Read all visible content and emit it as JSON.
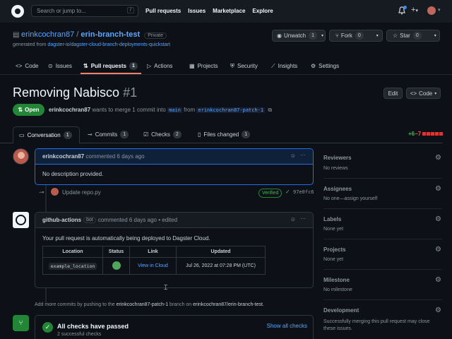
{
  "header": {
    "search_placeholder": "Search or jump to...",
    "search_key": "/",
    "nav": [
      "Pull requests",
      "Issues",
      "Marketplace",
      "Explore"
    ]
  },
  "repo": {
    "owner": "erinkcochran87",
    "slash": "/",
    "name": "erin-branch-test",
    "visibility": "Private",
    "generated_prefix": "generated from ",
    "generated_from": "dagster-io/dagster-cloud-branch-deployments-quickstart",
    "unwatch_label": "Unwatch",
    "unwatch_count": "1",
    "fork_label": "Fork",
    "fork_count": "0",
    "star_label": "Star",
    "star_count": "0"
  },
  "tabs": [
    {
      "label": "Code",
      "count": ""
    },
    {
      "label": "Issues",
      "count": ""
    },
    {
      "label": "Pull requests",
      "count": "1"
    },
    {
      "label": "Actions",
      "count": ""
    },
    {
      "label": "Projects",
      "count": ""
    },
    {
      "label": "Security",
      "count": ""
    },
    {
      "label": "Insights",
      "count": ""
    },
    {
      "label": "Settings",
      "count": ""
    }
  ],
  "pr": {
    "title": "Removing Nabisco",
    "number": "#1",
    "edit_label": "Edit",
    "code_label": "Code",
    "state": "Open",
    "meta_author": "erinkcochran87",
    "meta_text": " wants to merge 1 commit into ",
    "base_branch": "main",
    "from_text": " from ",
    "head_branch": "erinkcochran87-patch-1"
  },
  "pr_tabs": [
    {
      "label": "Conversation",
      "count": "1"
    },
    {
      "label": "Commits",
      "count": "1"
    },
    {
      "label": "Checks",
      "count": "2"
    },
    {
      "label": "Files changed",
      "count": "1"
    }
  ],
  "diffstat": {
    "add": "+6",
    "del": "−7"
  },
  "comment1": {
    "author": "erinkcochran87",
    "meta": "commented 6 days ago",
    "body": "No description provided."
  },
  "commit": {
    "message": "Update repo.py",
    "verified": "Verified",
    "sha": "97e0fc6"
  },
  "comment2": {
    "author": "github-actions",
    "bot": "bot",
    "meta": "commented 6 days ago • edited",
    "body": "Your pull request is automatically being deployed to Dagster Cloud.",
    "headers": [
      "Location",
      "Status",
      "Link",
      "Updated"
    ],
    "row": {
      "location": "example_location",
      "link": "View in Cloud",
      "updated": "Jul 26, 2022 at 07:28 PM (UTC)"
    }
  },
  "push_note": {
    "pre": "Add more commits by pushing to the ",
    "branch": "erinkcochran87-patch-1",
    "mid": " branch on ",
    "repo": "erinkcochran87/erin-branch-test",
    "post": "."
  },
  "checks": {
    "title": "All checks have passed",
    "sub": "2 successful checks",
    "show_all": "Show all checks"
  },
  "sidebar": [
    {
      "heading": "Reviewers",
      "value": "No reviews"
    },
    {
      "heading": "Assignees",
      "value": "No one—assign yourself"
    },
    {
      "heading": "Labels",
      "value": "None yet"
    },
    {
      "heading": "Projects",
      "value": "None yet"
    },
    {
      "heading": "Milestone",
      "value": "No milestone"
    },
    {
      "heading": "Development",
      "value": "Successfully merging this pull request may close these issues."
    }
  ]
}
